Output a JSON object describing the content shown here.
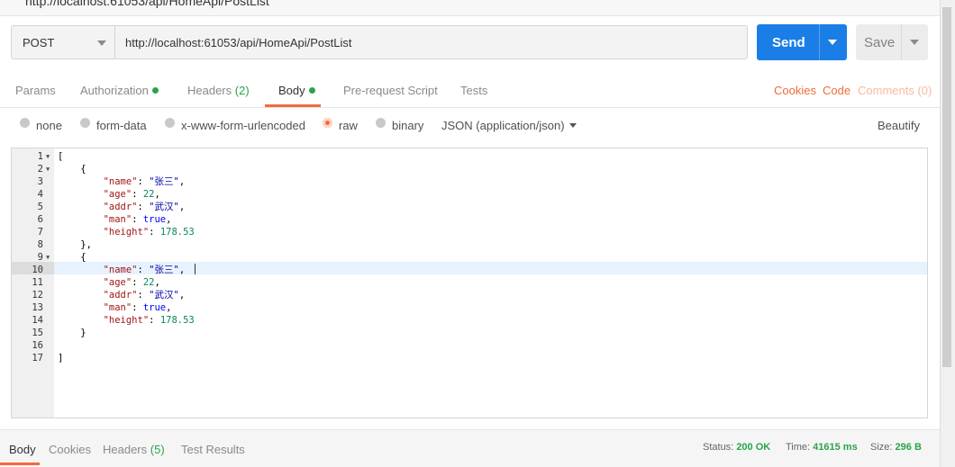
{
  "window": {
    "title": "http://localhost:61053/api/HomeApi/PostList"
  },
  "request": {
    "method": "POST",
    "url": "http://localhost:61053/api/HomeApi/PostList",
    "send_label": "Send",
    "save_label": "Save"
  },
  "tabs": {
    "params": "Params",
    "authorization": "Authorization",
    "headers": "Headers",
    "headers_count": "(2)",
    "body": "Body",
    "prerequest": "Pre-request Script",
    "tests": "Tests",
    "cookies": "Cookies",
    "code": "Code",
    "comments": "Comments (0)"
  },
  "body_types": {
    "none": "none",
    "form_data": "form-data",
    "urlencoded": "x-www-form-urlencoded",
    "raw": "raw",
    "binary": "binary",
    "selected": "raw",
    "content_type": "JSON (application/json)",
    "beautify": "Beautify"
  },
  "editor": {
    "line_numbers": [
      "1",
      "2",
      "3",
      "4",
      "5",
      "6",
      "7",
      "8",
      "9",
      "10",
      "11",
      "12",
      "13",
      "14",
      "15",
      "16",
      "17"
    ],
    "active_line": "10",
    "lines": [
      {
        "text": "["
      },
      {
        "text": "    {"
      },
      {
        "key": "\"name\"",
        "value": "\"张三\"",
        "type": "string",
        "end": ","
      },
      {
        "key": "\"age\"",
        "value": "22",
        "type": "number",
        "end": ","
      },
      {
        "key": "\"addr\"",
        "value": "\"武汉\"",
        "type": "string",
        "end": ","
      },
      {
        "key": "\"man\"",
        "value": "true",
        "type": "bool",
        "end": ","
      },
      {
        "key": "\"height\"",
        "value": "178.53",
        "type": "number",
        "end": ""
      },
      {
        "text": "    },"
      },
      {
        "text": "    {"
      },
      {
        "key": "\"name\"",
        "value": "\"张三\"",
        "type": "string",
        "end": ","
      },
      {
        "key": "\"age\"",
        "value": "22",
        "type": "number",
        "end": ","
      },
      {
        "key": "\"addr\"",
        "value": "\"武汉\"",
        "type": "string",
        "end": ","
      },
      {
        "key": "\"man\"",
        "value": "true",
        "type": "bool",
        "end": ","
      },
      {
        "key": "\"height\"",
        "value": "178.53",
        "type": "number",
        "end": ""
      },
      {
        "text": "    }"
      },
      {
        "text": ""
      },
      {
        "text": "]"
      }
    ]
  },
  "response": {
    "tabs": {
      "body": "Body",
      "cookies": "Cookies",
      "headers": "Headers",
      "headers_count": "(5)",
      "test_results": "Test Results"
    },
    "status_label": "Status:",
    "status_value": "200 OK",
    "time_label": "Time:",
    "time_value": "41615 ms",
    "size_label": "Size:",
    "size_value": "296 B"
  },
  "colors": {
    "accent": "#f26b3a",
    "send": "#1a7ee6",
    "success": "#2aa34a"
  }
}
